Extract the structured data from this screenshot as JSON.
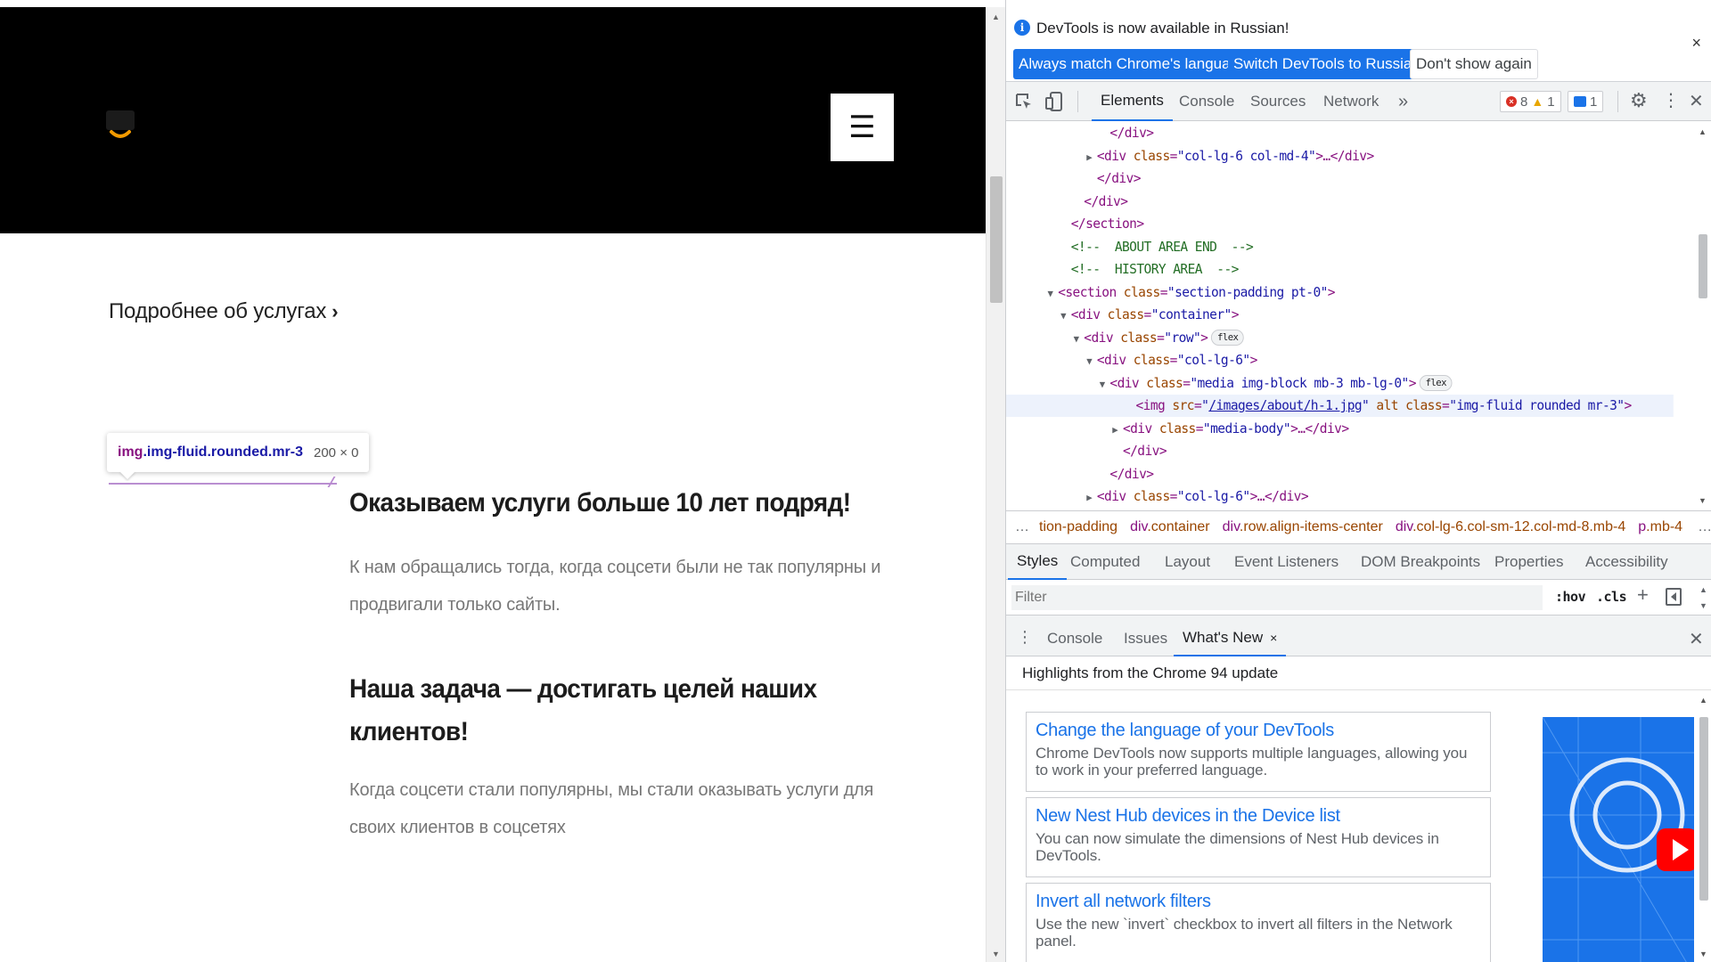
{
  "page": {
    "menu_icon": "hamburger-icon",
    "menu_glyph": "☰",
    "more_link": "Подробнее об услугах",
    "more_chevron": "›",
    "heading1": "Оказываем услуги больше 10 лет подряд!",
    "paragraph1": "К нам обращались тогда, когда соцсети были не так популярны и продвигали только сайты.",
    "heading2": "Наша задача — достигать целей наших клиентов!",
    "paragraph2": "Когда соцсети стали популярны, мы стали оказывать услуги для своих клиентов в соцсетях"
  },
  "inspect_tooltip": {
    "tag": "img",
    "classes": ".img-fluid.rounded.mr-3",
    "size": "200 × 0"
  },
  "devtools": {
    "infobar": {
      "message": "DevTools is now available in Russian!",
      "btn_match": "Always match Chrome's language",
      "btn_switch": "Switch DevTools to Russian",
      "btn_dont": "Don't show again",
      "close": "×"
    },
    "tabs": {
      "elements": "Elements",
      "console": "Console",
      "sources": "Sources",
      "network": "Network",
      "more": "»"
    },
    "counts": {
      "errors": "8",
      "warnings": "1",
      "messages": "1"
    },
    "dom_lines": [
      {
        "indent": 6,
        "html": "</div>"
      },
      {
        "indent": 5,
        "twisty": "▶",
        "html": "<div class=\"col-lg-6 col-md-4\">…</div>"
      },
      {
        "indent": 5,
        "html": "</div>"
      },
      {
        "indent": 4,
        "html": "</div>"
      },
      {
        "indent": 3,
        "html": "</section>"
      },
      {
        "indent": 3,
        "comment": "<!--  ABOUT AREA END  -->"
      },
      {
        "indent": 3,
        "comment": "<!--  HISTORY AREA  -->"
      },
      {
        "indent": 2,
        "twisty": "▼",
        "html": "<section class=\"section-padding pt-0\">"
      },
      {
        "indent": 3,
        "twisty": "▼",
        "html": "<div class=\"container\">"
      },
      {
        "indent": 4,
        "twisty": "▼",
        "html": "<div class=\"row\">",
        "badge": "flex"
      },
      {
        "indent": 5,
        "twisty": "▼",
        "html": "<div class=\"col-lg-6\">"
      },
      {
        "indent": 6,
        "twisty": "▼",
        "html": "<div class=\"media img-block mb-3 mb-lg-0\">",
        "badge": "flex"
      },
      {
        "indent": 8,
        "html": "<img src=\"/images/about/h-1.jpg\" alt class=\"img-fluid rounded mr-3\">",
        "highlight": true
      },
      {
        "indent": 7,
        "twisty": "▶",
        "html": "<div class=\"media-body\">…</div>"
      },
      {
        "indent": 7,
        "html": "</div>"
      },
      {
        "indent": 6,
        "html": "</div>"
      },
      {
        "indent": 5,
        "twisty": "▶",
        "html": "<div class=\"col-lg-6\">…</div>"
      }
    ],
    "breadcrumbs": {
      "leading": "…",
      "items": [
        {
          "tag": "",
          "cls": "tion-padding"
        },
        {
          "tag": "div",
          "cls": ".container"
        },
        {
          "tag": "div",
          "cls": ".row.align-items-center"
        },
        {
          "tag": "div",
          "cls": ".col-lg-6.col-sm-12.col-md-8.mb-4"
        },
        {
          "tag": "p",
          "cls": ".mb-4"
        }
      ],
      "trailing": "…"
    },
    "style_tabs": {
      "styles": "Styles",
      "computed": "Computed",
      "layout": "Layout",
      "event_listeners": "Event Listeners",
      "dom_breakpoints": "DOM Breakpoints",
      "properties": "Properties",
      "accessibility": "Accessibility"
    },
    "filter": {
      "placeholder": "Filter",
      "hov": ":hov",
      "cls": ".cls",
      "plus": "+"
    },
    "drawer": {
      "console": "Console",
      "issues": "Issues",
      "whats_new": "What's New",
      "whats_new_close": "×",
      "close": "×",
      "header": "Highlights from the Chrome 94 update",
      "cards": [
        {
          "title": "Change the language of your DevTools",
          "desc": "Chrome DevTools now supports multiple languages, allowing you to work in your preferred language."
        },
        {
          "title": "New Nest Hub devices in the Device list",
          "desc": "You can now simulate the dimensions of Nest Hub devices in DevTools."
        },
        {
          "title": "Invert all network filters",
          "desc": "Use the new `invert` checkbox to invert all filters in the Network panel."
        }
      ]
    }
  },
  "colors": {
    "accent": "#1a73e8",
    "tag": "#881280",
    "attr_name": "#994500",
    "attr_value": "#1a1aa6",
    "comment": "#236e25",
    "header_bg": "#000000"
  }
}
